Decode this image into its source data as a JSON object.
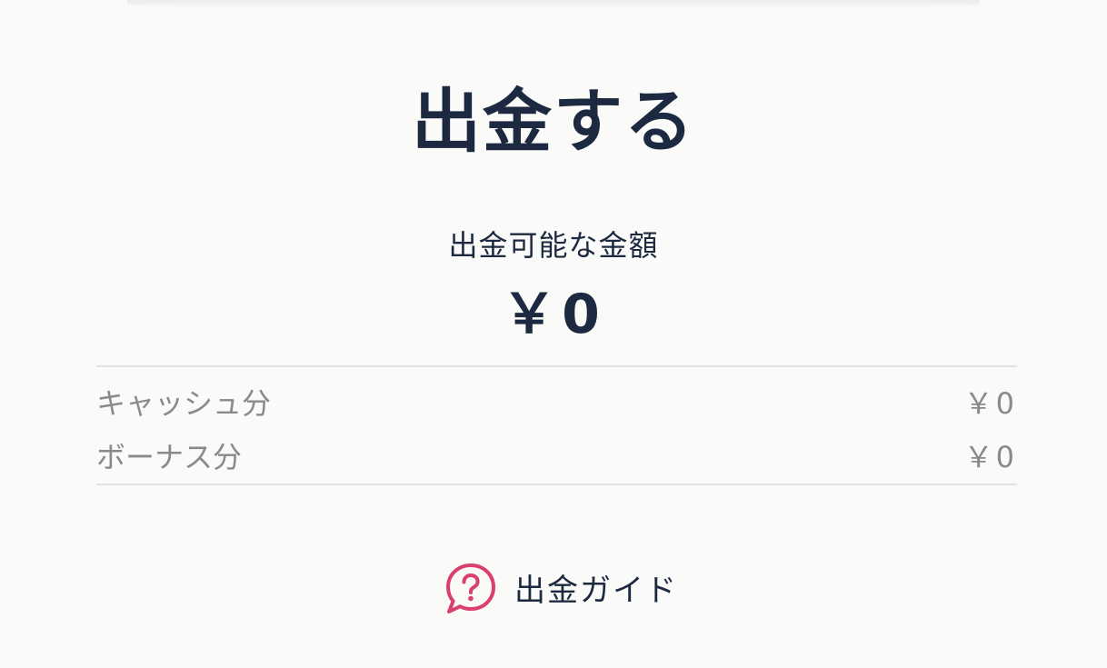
{
  "page": {
    "title": "出金する"
  },
  "balance": {
    "label": "出金可能な金額",
    "amount": "￥0"
  },
  "breakdown": [
    {
      "label": "キャッシュ分",
      "value": "￥0"
    },
    {
      "label": "ボーナス分",
      "value": "￥0"
    }
  ],
  "guide": {
    "label": "出金ガイド",
    "icon": "question-speech-bubble-icon"
  },
  "colors": {
    "background": "#fafaf8",
    "text_primary": "#1c2940",
    "text_secondary": "#8a8a8a",
    "divider": "#e3e3e1",
    "accent": "#d9406e"
  }
}
